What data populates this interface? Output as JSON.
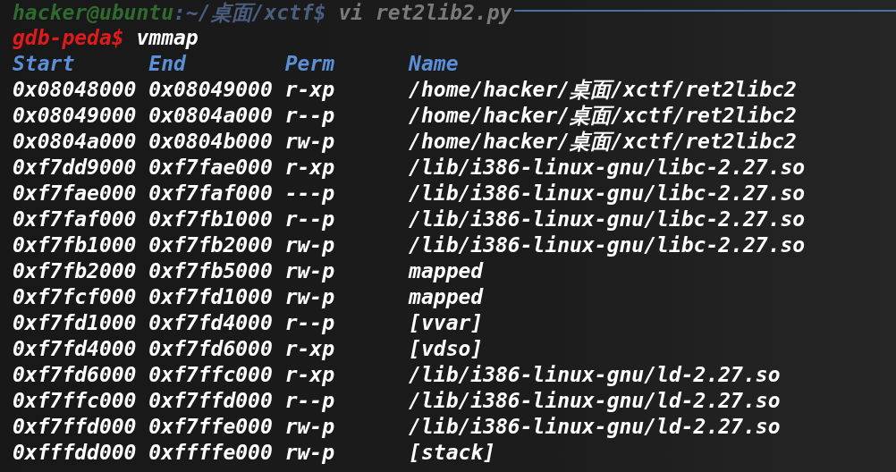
{
  "previous_line": {
    "prompt": "hacker@ubuntu",
    "path": ":~/桌面/xctf$",
    "command": "vi ret2lib2.py"
  },
  "gdb_line": {
    "prompt": "gdb-peda$",
    "command": "vmmap"
  },
  "columns": [
    "Start",
    "End",
    "Perm",
    "Name"
  ],
  "rows": [
    [
      "0x08048000",
      "0x08049000",
      "r-xp",
      "/home/hacker/桌面/xctf/ret2libc2"
    ],
    [
      "0x08049000",
      "0x0804a000",
      "r--p",
      "/home/hacker/桌面/xctf/ret2libc2"
    ],
    [
      "0x0804a000",
      "0x0804b000",
      "rw-p",
      "/home/hacker/桌面/xctf/ret2libc2"
    ],
    [
      "0xf7dd9000",
      "0xf7fae000",
      "r-xp",
      "/lib/i386-linux-gnu/libc-2.27.so"
    ],
    [
      "0xf7fae000",
      "0xf7faf000",
      "---p",
      "/lib/i386-linux-gnu/libc-2.27.so"
    ],
    [
      "0xf7faf000",
      "0xf7fb1000",
      "r--p",
      "/lib/i386-linux-gnu/libc-2.27.so"
    ],
    [
      "0xf7fb1000",
      "0xf7fb2000",
      "rw-p",
      "/lib/i386-linux-gnu/libc-2.27.so"
    ],
    [
      "0xf7fb2000",
      "0xf7fb5000",
      "rw-p",
      "mapped"
    ],
    [
      "0xf7fcf000",
      "0xf7fd1000",
      "rw-p",
      "mapped"
    ],
    [
      "0xf7fd1000",
      "0xf7fd4000",
      "r--p",
      "[vvar]"
    ],
    [
      "0xf7fd4000",
      "0xf7fd6000",
      "r-xp",
      "[vdso]"
    ],
    [
      "0xf7fd6000",
      "0xf7ffc000",
      "r-xp",
      "/lib/i386-linux-gnu/ld-2.27.so"
    ],
    [
      "0xf7ffc000",
      "0xf7ffd000",
      "r--p",
      "/lib/i386-linux-gnu/ld-2.27.so"
    ],
    [
      "0xf7ffd000",
      "0xf7ffe000",
      "rw-p",
      "/lib/i386-linux-gnu/ld-2.27.so"
    ],
    [
      "0xfffdd000",
      "0xffffe000",
      "rw-p",
      "[stack]"
    ]
  ]
}
